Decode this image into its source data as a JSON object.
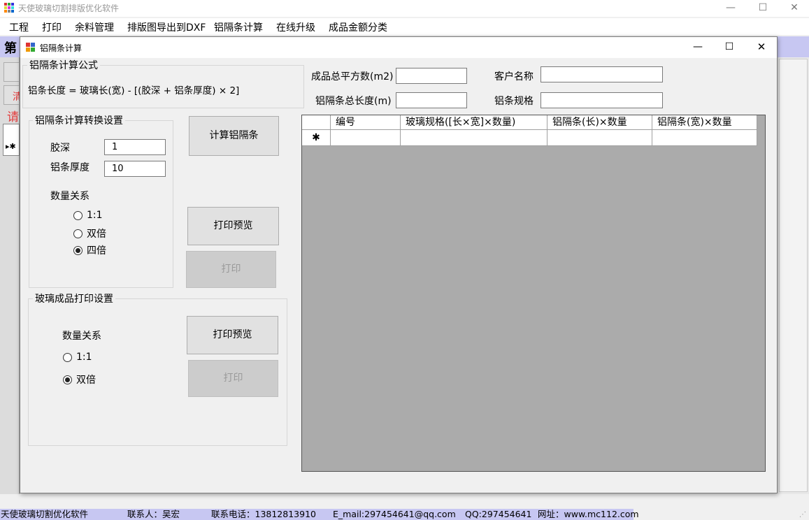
{
  "app": {
    "title": "天使玻璃切割排版优化软件",
    "menu": [
      "工程",
      "打印",
      "余料管理",
      "排版图导出到DXF",
      "铝隔条计算",
      "在线升级",
      "成品金额分类"
    ],
    "background_fragments": {
      "di": "第",
      "qing": "清",
      "qing2": "请",
      "row_marker": "▸✱"
    }
  },
  "dialog": {
    "title": "铝隔条计算",
    "formula_group": {
      "title": "铝隔条计算公式",
      "formula": "铝条长度 = 玻璃长(宽) - [(胶深 + 铝条厚度) × 2]"
    },
    "summary": {
      "total_area_label": "成品总平方数(m2)",
      "total_area_value": "",
      "customer_label": "客户名称",
      "customer_value": "",
      "total_length_label": "铝隔条总长度(m)",
      "total_length_value": "",
      "spec_label": "铝条规格",
      "spec_value": ""
    },
    "conversion_group": {
      "title": "铝隔条计算转换设置",
      "depth_label": "胶深",
      "depth_value": "1",
      "thickness_label": "铝条厚度",
      "thickness_value": "10",
      "qty_label": "数量关系",
      "options": [
        "1:1",
        "双倍",
        "四倍"
      ],
      "selected": "四倍"
    },
    "buttons": {
      "calculate": "计算铝隔条",
      "preview1": "打印预览",
      "print1": "打印",
      "preview2": "打印预览",
      "print2": "打印"
    },
    "glass_group": {
      "title": "玻璃成品打印设置",
      "qty_label": "数量关系",
      "options": [
        "1:1",
        "双倍"
      ],
      "selected": "双倍"
    },
    "grid": {
      "columns": [
        "编号",
        "玻璃规格([长×宽]×数量)",
        "铝隔条(长)×数量",
        "铝隔条(宽)×数量"
      ],
      "new_row_marker": "✱"
    }
  },
  "status": {
    "app": "天使玻璃切割优化软件",
    "contact": "联系人：吴宏",
    "phone": "联系电话：13812813910",
    "email": "E_mail:297454641@qq.com",
    "qq": "QQ:297454641",
    "web": "网址：www.mc112.com"
  },
  "colors": {
    "accent_strip": "#c7c7f2",
    "grid_bg": "#ababab",
    "fragment_red": "#e23a3a"
  }
}
